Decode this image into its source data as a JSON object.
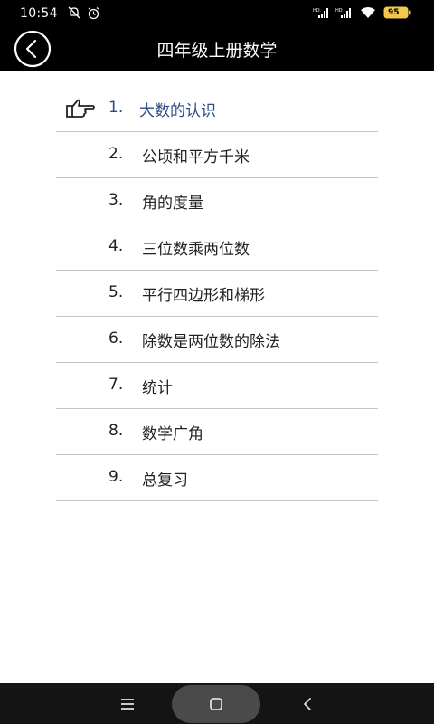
{
  "status_bar": {
    "time": "10:54",
    "battery": "95"
  },
  "app_bar": {
    "title": "四年级上册数学",
    "back_icon": "back-circle-icon"
  },
  "chapters": [
    {
      "num": "1.",
      "label": "大数的认识",
      "selected": true
    },
    {
      "num": "2.",
      "label": "公顷和平方千米",
      "selected": false
    },
    {
      "num": "3.",
      "label": "角的度量",
      "selected": false
    },
    {
      "num": "4.",
      "label": "三位数乘两位数",
      "selected": false
    },
    {
      "num": "5.",
      "label": "平行四边形和梯形",
      "selected": false
    },
    {
      "num": "6.",
      "label": "除数是两位数的除法",
      "selected": false
    },
    {
      "num": "7.",
      "label": "统计",
      "selected": false
    },
    {
      "num": "8.",
      "label": "数学广角",
      "selected": false
    },
    {
      "num": "9.",
      "label": "总复习",
      "selected": false
    }
  ],
  "colors": {
    "selected_text": "#2a4d8a",
    "bar_bg": "#000000"
  }
}
